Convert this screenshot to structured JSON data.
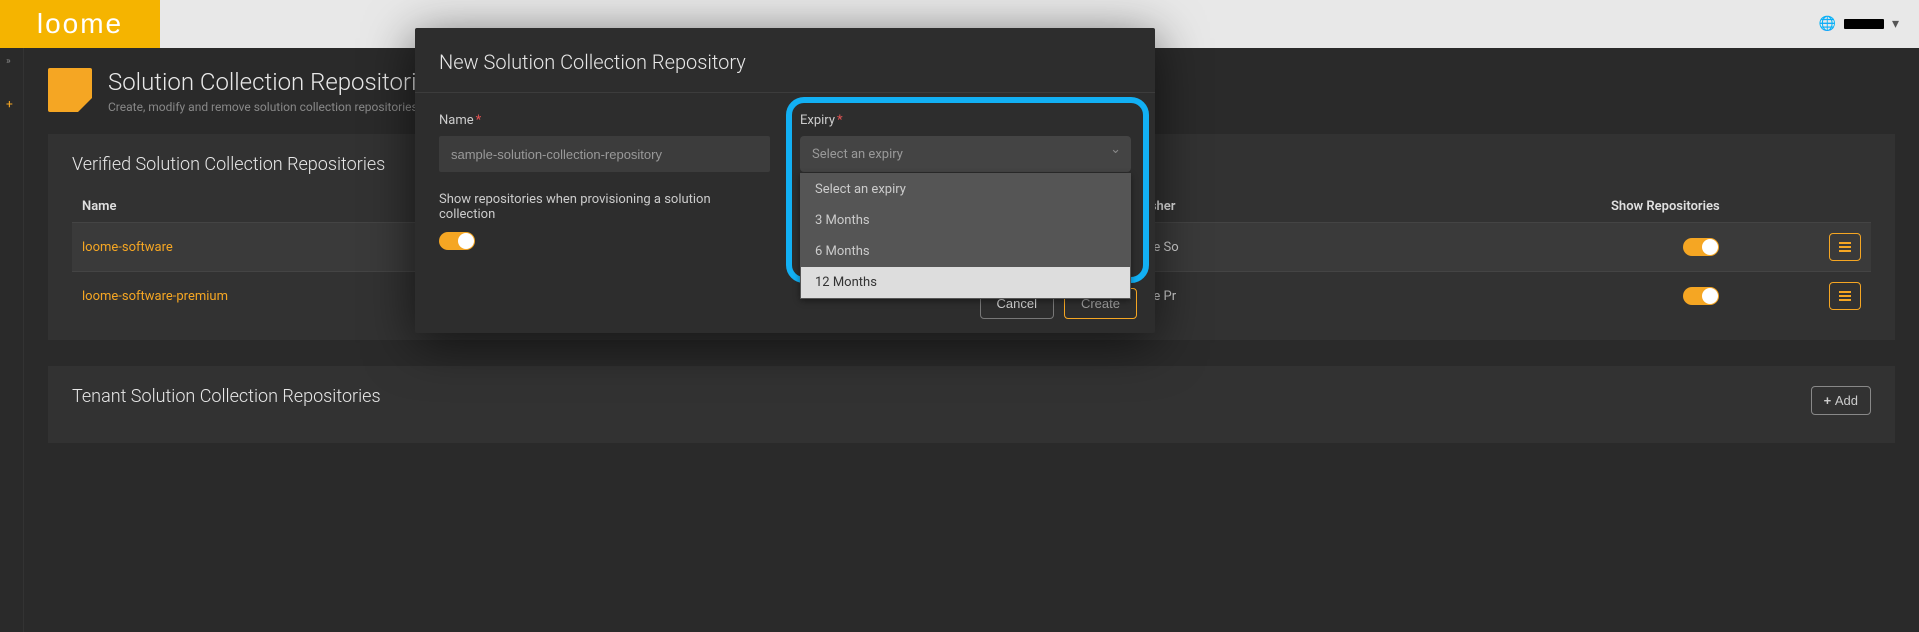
{
  "header": {
    "logo_text": "loome",
    "globe_icon": "🌐",
    "caret": "▾"
  },
  "leftRail": {
    "expand": "»",
    "add": "+"
  },
  "page": {
    "title": "Solution Collection Repositories",
    "subtitle": "Create, modify and remove solution collection repositories."
  },
  "verifiedPanel": {
    "title": "Verified Solution Collection Repositories",
    "columns": {
      "name": "Name",
      "publisher": "Publisher",
      "show": "Show Repositories"
    },
    "rows": [
      {
        "name": "loome-software",
        "publisher": "Loome So"
      },
      {
        "name": "loome-software-premium",
        "publisher": "Loome Pr"
      }
    ]
  },
  "tenantPanel": {
    "title": "Tenant Solution Collection Repositories",
    "addLabel": "Add"
  },
  "modal": {
    "title": "New Solution Collection Repository",
    "nameLabel": "Name",
    "namePlaceholder": "sample-solution-collection-repository",
    "expiryLabel": "Expiry",
    "expiryPlaceholder": "Select an expiry",
    "showReposLabel": "Show repositories when provisioning a solution collection",
    "dropdown": {
      "opt0": "Select an expiry",
      "opt1": "3 Months",
      "opt2": "6 Months",
      "opt3": "12 Months"
    },
    "cancel": "Cancel",
    "create": "Create"
  }
}
